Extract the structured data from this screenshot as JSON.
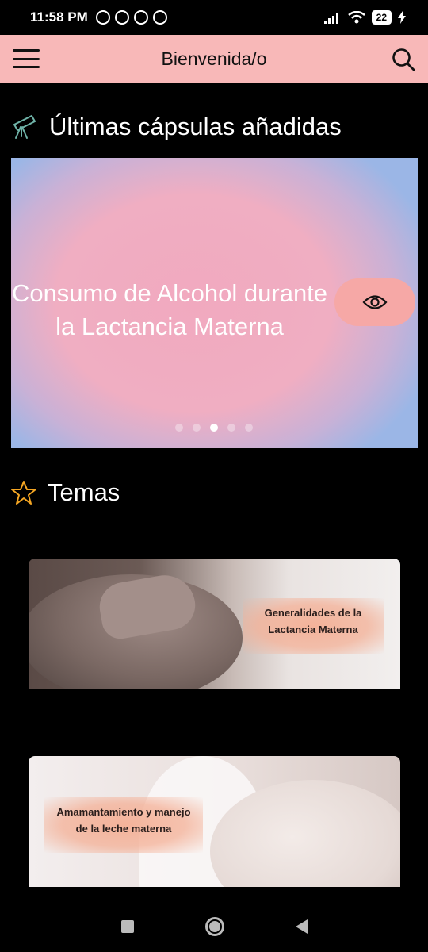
{
  "status_bar": {
    "time": "11:58 PM",
    "battery": "22",
    "icons": [
      "alarm-icon",
      "pinterest-icon",
      "notification-icon",
      "notification-icon",
      "signal-icon",
      "wifi-icon",
      "battery-icon",
      "charging-icon"
    ]
  },
  "app_bar": {
    "title": "Bienvenida/o",
    "menu_icon": "hamburger-menu-icon",
    "search_icon": "search-icon",
    "background": "#f8b8b8"
  },
  "latest": {
    "heading": "Últimas cápsulas añadidas",
    "icon": "telescope-icon",
    "slide_title": "Consumo de Alcohol durante la Lactancia Materna",
    "view_icon": "eye-icon",
    "dot_count": 5,
    "active_dot": 2
  },
  "topics": {
    "heading": "Temas",
    "icon": "star-icon",
    "accent": "#f5a623",
    "cards": [
      {
        "label": "Generalidades de la Lactancia Materna"
      },
      {
        "label": "Amamantamiento y manejo de la leche materna"
      }
    ]
  },
  "nav": {
    "recent_icon": "recent-apps-icon",
    "home_icon": "home-icon",
    "back_icon": "back-icon"
  }
}
